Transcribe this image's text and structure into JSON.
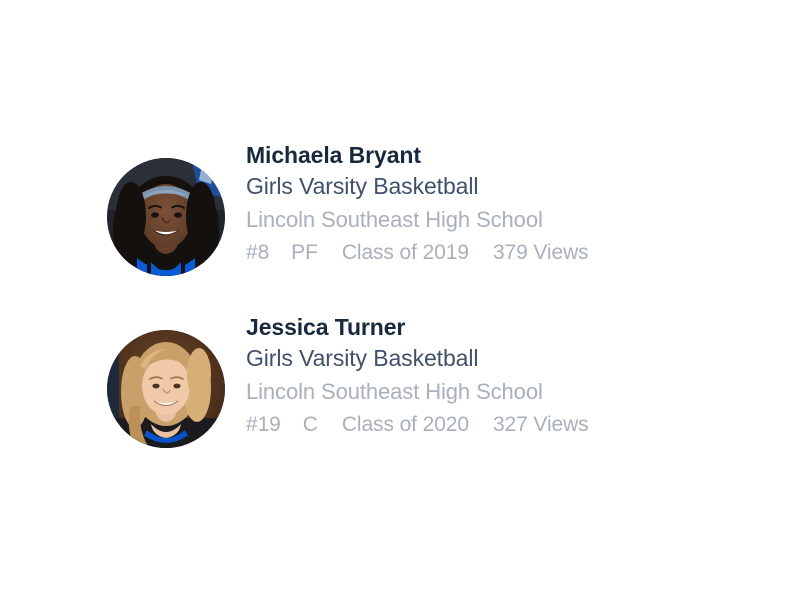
{
  "page": {
    "background_color": "#ffffff",
    "name_color": "#18293e",
    "team_color": "#3f516a",
    "muted_color": "#a9b0bc"
  },
  "roster": {
    "players": [
      {
        "name": "Michaela Bryant",
        "team": "Girls Varsity Basketball",
        "school": "Lincoln Southeast High School",
        "jersey_number": "#8",
        "position": "PF",
        "class_year": "Class of 2019",
        "views": "379 Views",
        "avatar": {
          "icon_name": "player-avatar-michaela-bryant",
          "description": "Smiling young woman with curly dark hair and a blue-gray headband wearing a blue and black basketball jersey",
          "background_color": "#20232a",
          "hair_color": "#14100e",
          "skin_color": "#6b4530",
          "jersey_color": "#0a5bd6",
          "accent_color": "#1d4f9c"
        }
      },
      {
        "name": "Jessica Turner",
        "team": "Girls Varsity Basketball",
        "school": "Lincoln Southeast High School",
        "jersey_number": "#19",
        "position": "C",
        "class_year": "Class of 2020",
        "views": "327 Views",
        "avatar": {
          "icon_name": "player-avatar-jessica-turner",
          "description": "Smiling blonde woman with long wavy hair wearing a black top with a blue collar stripe on a brown backdrop",
          "background_color": "#5d3a22",
          "hair_color": "#c9a06a",
          "skin_color": "#e3b99a",
          "jersey_color": "#1b1b1f",
          "accent_color": "#0a53c8"
        }
      }
    ]
  }
}
